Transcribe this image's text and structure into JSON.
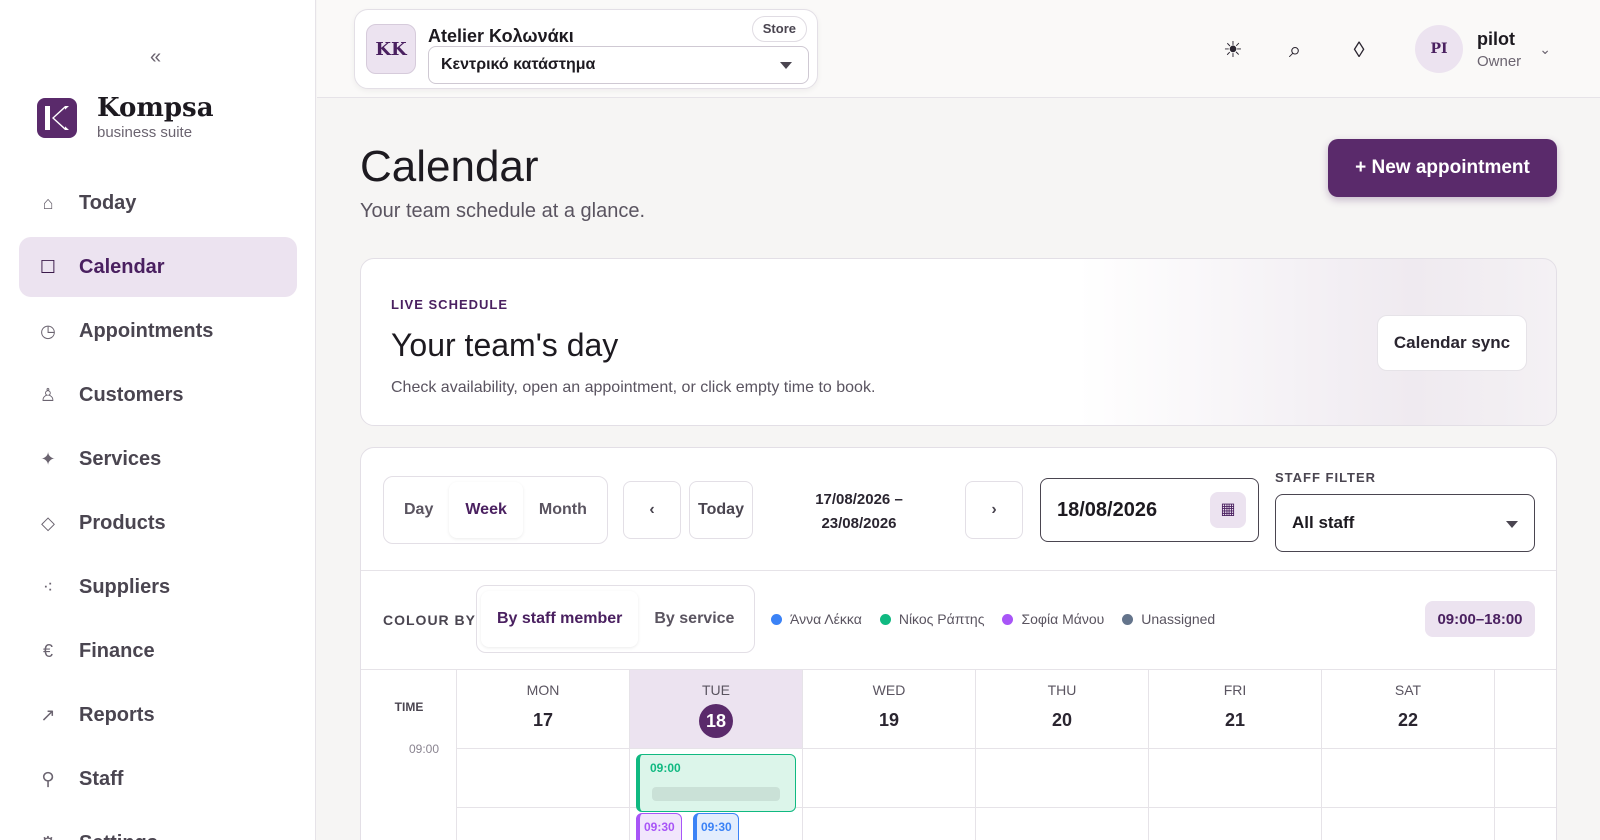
{
  "sidebar": {
    "collapse_glyph": "«",
    "brand": {
      "name": "Kompsa",
      "subtitle": "business suite",
      "logo_letter": "K"
    },
    "items": [
      {
        "label": "Today",
        "icon": "home-icon",
        "glyph": "⌂"
      },
      {
        "label": "Calendar",
        "icon": "calendar-icon",
        "glyph": "☐"
      },
      {
        "label": "Appointments",
        "icon": "clock-icon",
        "glyph": "◷"
      },
      {
        "label": "Customers",
        "icon": "person-icon",
        "glyph": "♙"
      },
      {
        "label": "Services",
        "icon": "sparkle-icon",
        "glyph": "✦"
      },
      {
        "label": "Products",
        "icon": "diamond-icon",
        "glyph": "◇"
      },
      {
        "label": "Suppliers",
        "icon": "network-icon",
        "glyph": "⁖"
      },
      {
        "label": "Finance",
        "icon": "euro-icon",
        "glyph": "€"
      },
      {
        "label": "Reports",
        "icon": "trend-arrow-icon",
        "glyph": "↗"
      },
      {
        "label": "Staff",
        "icon": "staff-icon",
        "glyph": "⚲"
      },
      {
        "label": "Settings",
        "icon": "settings-icon",
        "glyph": "⚙"
      }
    ],
    "active_index": 1
  },
  "topbar": {
    "store": {
      "initials": "KK",
      "name": "Atelier Κολωνάκι",
      "tag": "Store",
      "location": "Κεντρικό κατάστημα"
    },
    "icons": {
      "theme": "☀",
      "search": "⌕",
      "diamond": "◊"
    },
    "user": {
      "initials": "PI",
      "name": "pilot",
      "role": "Owner",
      "chevron": "⌄"
    }
  },
  "page": {
    "title": "Calendar",
    "subtitle": "Your team schedule at a glance.",
    "new_button": "+ New appointment"
  },
  "live": {
    "eyebrow": "LIVE SCHEDULE",
    "title": "Your team's day",
    "description": "Check availability, open an appointment, or click empty time to book.",
    "sync_button": "Calendar sync"
  },
  "calendar": {
    "views": [
      "Day",
      "Week",
      "Month"
    ],
    "active_view": "Week",
    "prev": "‹",
    "today_button": "Today",
    "next": "›",
    "range_start": "17/08/2026 –",
    "range_end": "23/08/2026",
    "date_value": "18/08/2026",
    "date_icon": "▦",
    "staff_filter_label": "STAFF FILTER",
    "staff_filter_value": "All staff",
    "colour_by_label": "COLOUR BY",
    "colour_modes": [
      "By staff member",
      "By service"
    ],
    "legend": [
      {
        "name": "Άννα Λέκκα",
        "color": "#3b82f6"
      },
      {
        "name": "Νίκος Ράπτης",
        "color": "#10b981"
      },
      {
        "name": "Σοφία Μάνου",
        "color": "#a855f7"
      },
      {
        "name": "Unassigned",
        "color": "#64748b"
      }
    ],
    "hours": "09:00–18:00",
    "time_header": "TIME",
    "time_label": "09:00",
    "days": [
      {
        "name": "MON",
        "num": "17"
      },
      {
        "name": "TUE",
        "num": "18"
      },
      {
        "name": "WED",
        "num": "19"
      },
      {
        "name": "THU",
        "num": "20"
      },
      {
        "name": "FRI",
        "num": "21"
      },
      {
        "name": "SAT",
        "num": "22"
      }
    ],
    "appointments": [
      {
        "time": "09:00",
        "color": "#10b981",
        "bg": "#dcf5ea"
      },
      {
        "time": "09:30",
        "color": "#a855f7",
        "bg": "#f1e6fc"
      },
      {
        "time": "09:30",
        "color": "#3b82f6",
        "bg": "#e3edfd"
      }
    ]
  }
}
